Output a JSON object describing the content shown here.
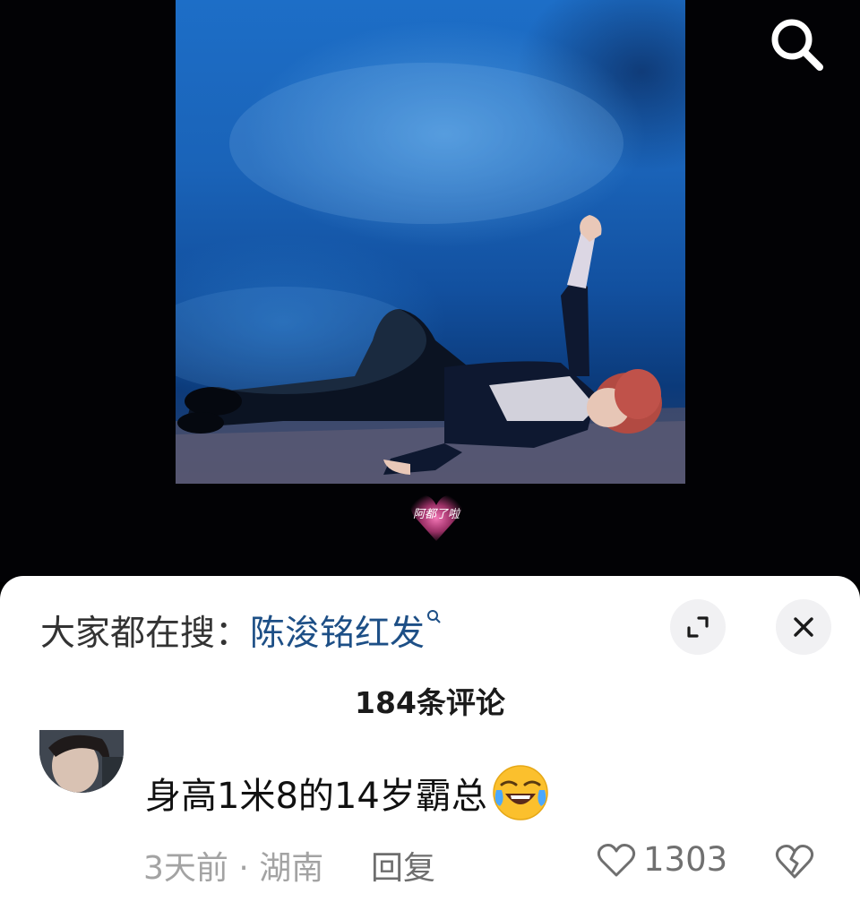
{
  "search_bar": {
    "label": "大家都在搜：",
    "term": "陈浚铭红发"
  },
  "comments_header": {
    "count_text": "184条评论"
  },
  "comment": {
    "text": "身高1米8的14岁霸总",
    "emoji": "crying-laughing-face",
    "time": "3天前",
    "separator": " · ",
    "location": "湖南",
    "reply_label": "回复",
    "like_count": "1303"
  },
  "watermark": {
    "text": "阿都了啦"
  },
  "colors": {
    "link": "#1d4f86",
    "video_blue": "#1a63b8",
    "sheet_bg": "#ffffff"
  }
}
